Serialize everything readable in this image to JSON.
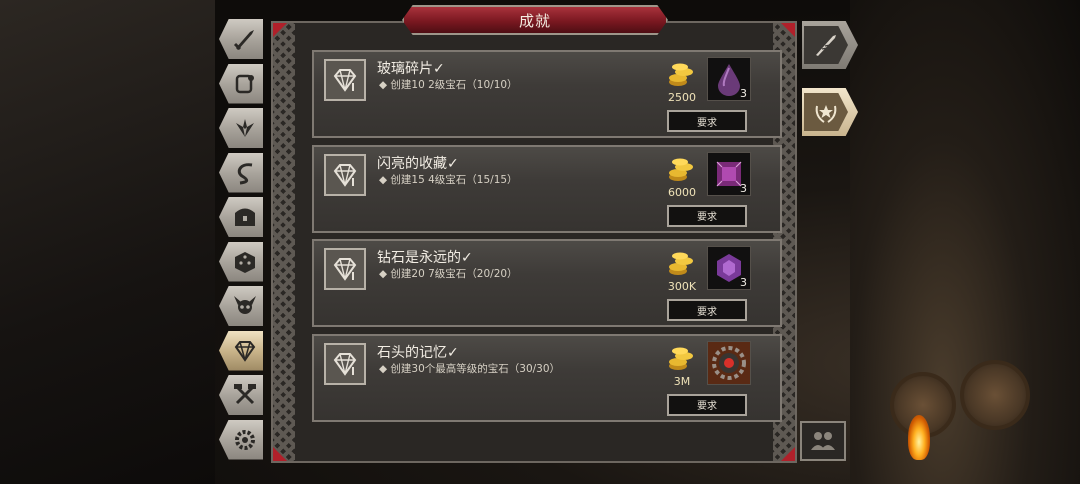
{
  "window": {
    "title": "成就"
  },
  "colors": {
    "title_bar": "#7a1820",
    "coin_text": "#efe2b8",
    "active_tab": "#c9b48a"
  },
  "tabs": [
    {
      "name": "weapon-icon"
    },
    {
      "name": "scroll-icon"
    },
    {
      "name": "wings-icon"
    },
    {
      "name": "whip-icon"
    },
    {
      "name": "chest-icon"
    },
    {
      "name": "dice-icon"
    },
    {
      "name": "horned-skull-icon"
    },
    {
      "name": "gem-icon",
      "active": true
    },
    {
      "name": "hammers-icon"
    },
    {
      "name": "gear-icon"
    }
  ],
  "achievements": [
    {
      "title": "玻璃碎片✓",
      "desc": "◆ 创建10 2级宝石（10/10）",
      "gold": "2500",
      "item_qty": "3",
      "item": "teardrop-gem",
      "button": "要求"
    },
    {
      "title": "闪亮的收藏✓",
      "desc": "◆ 创建15 4级宝石（15/15）",
      "gold": "6000",
      "item_qty": "3",
      "item": "square-gem",
      "button": "要求"
    },
    {
      "title": "钻石是永远的✓",
      "desc": "◆ 创建20 7级宝石（20/20）",
      "gold": "300K",
      "item_qty": "3",
      "item": "hexagon-gem",
      "button": "要求"
    },
    {
      "title": "石头的记忆✓",
      "desc": "◆ 创建30个最高等级的宝石（30/30）",
      "gold": "3M",
      "item_qty": "",
      "item": "cog-amulet",
      "button": "要求"
    }
  ],
  "right_buttons": [
    {
      "name": "quill-icon"
    },
    {
      "name": "laurel-star-icon",
      "active": true
    }
  ],
  "social": {
    "name": "friends-icon"
  }
}
